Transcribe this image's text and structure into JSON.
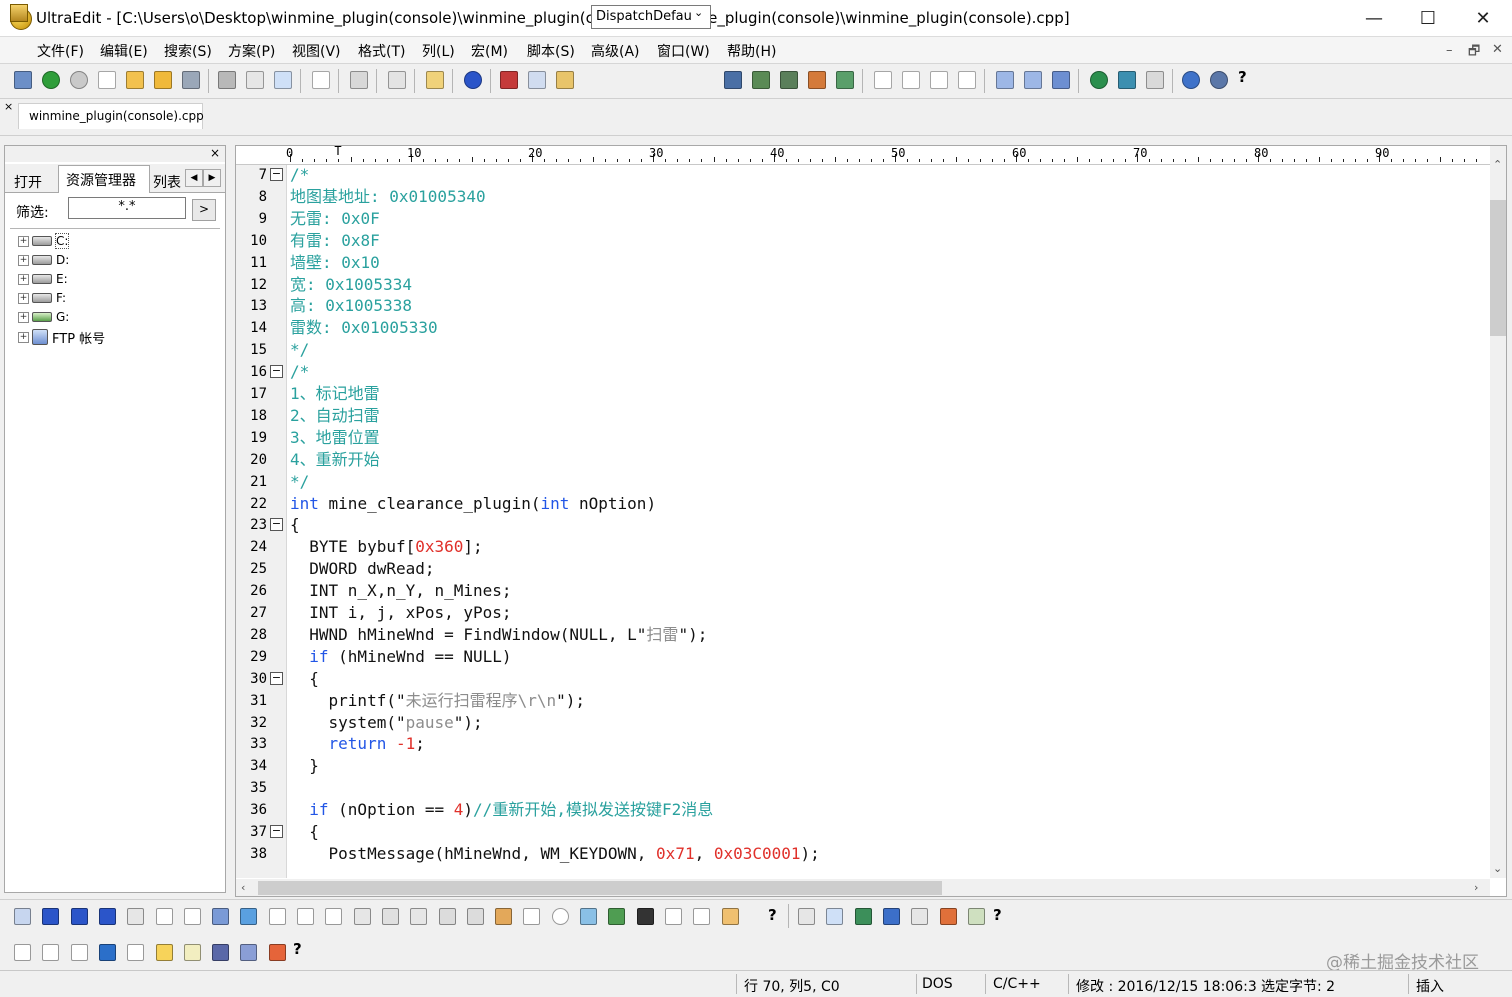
{
  "window": {
    "title": "UltraEdit - [C:\\Users\\o\\Desktop\\winmine_plugin(console)\\winmine_plugin(console)\\winmine_plugin(console)\\winmine_plugin(console).cpp]",
    "minimize": "—",
    "maximize": "☐",
    "close": "✕"
  },
  "menu": [
    "文件(F)",
    "编辑(E)",
    "搜索(S)",
    "方案(P)",
    "视图(V)",
    "格式(T)",
    "列(L)",
    "宏(M)",
    "脚本(S)",
    "高级(A)",
    "窗口(W)",
    "帮助(H)"
  ],
  "mdi": {
    "minimize": "–",
    "restore": "🗗",
    "close": "✕"
  },
  "toolbar": {
    "function_select": "DispatchDefau",
    "help_label": "?"
  },
  "tab": {
    "file": "winmine_plugin(console).cpp",
    "close": "×"
  },
  "panel": {
    "close": "×",
    "tabs": [
      "打开",
      "资源管理器",
      "列表"
    ],
    "filter_label": "筛选:",
    "filter_value": "*.*",
    "filter_go": ">",
    "tree": [
      {
        "label": "C:",
        "icon": "drive-icon"
      },
      {
        "label": "D:",
        "icon": "drive-icon"
      },
      {
        "label": "E:",
        "icon": "drive-icon"
      },
      {
        "label": "F:",
        "icon": "drive-icon"
      },
      {
        "label": "G:",
        "icon": "network-drive-icon"
      },
      {
        "label": "FTP 帐号",
        "icon": "ftp-icon"
      }
    ]
  },
  "ruler": {
    "labels": [
      "0",
      "10",
      "20",
      "30",
      "40",
      "50",
      "60",
      "70",
      "80",
      "90"
    ],
    "cursor_mark": "T"
  },
  "code": [
    {
      "n": "7",
      "fold": true,
      "parts": [
        [
          "c",
          "/*"
        ]
      ]
    },
    {
      "n": "8",
      "parts": [
        [
          "c",
          "地图基地址: 0x01005340"
        ]
      ]
    },
    {
      "n": "9",
      "parts": [
        [
          "c",
          "无雷: 0x0F"
        ]
      ]
    },
    {
      "n": "10",
      "parts": [
        [
          "c",
          "有雷: 0x8F"
        ]
      ]
    },
    {
      "n": "11",
      "parts": [
        [
          "c",
          "墙壁: 0x10"
        ]
      ]
    },
    {
      "n": "12",
      "parts": [
        [
          "c",
          "宽: 0x1005334"
        ]
      ]
    },
    {
      "n": "13",
      "parts": [
        [
          "c",
          "高: 0x1005338"
        ]
      ]
    },
    {
      "n": "14",
      "parts": [
        [
          "c",
          "雷数: 0x01005330"
        ]
      ]
    },
    {
      "n": "15",
      "parts": [
        [
          "c",
          "*/"
        ]
      ]
    },
    {
      "n": "16",
      "fold": true,
      "parts": [
        [
          "c",
          "/*"
        ]
      ]
    },
    {
      "n": "17",
      "parts": [
        [
          "c",
          "1、标记地雷"
        ]
      ]
    },
    {
      "n": "18",
      "parts": [
        [
          "c",
          "2、自动扫雷"
        ]
      ]
    },
    {
      "n": "19",
      "parts": [
        [
          "c",
          "3、地雷位置"
        ]
      ]
    },
    {
      "n": "20",
      "parts": [
        [
          "c",
          "4、重新开始"
        ]
      ]
    },
    {
      "n": "21",
      "parts": [
        [
          "c",
          "*/"
        ]
      ]
    },
    {
      "n": "22",
      "parts": [
        [
          "k",
          "int"
        ],
        [
          "t",
          " mine_clearance_plugin("
        ],
        [
          "k",
          "int"
        ],
        [
          "t",
          " nOption)"
        ]
      ]
    },
    {
      "n": "23",
      "fold": true,
      "parts": [
        [
          "t",
          "{"
        ]
      ]
    },
    {
      "n": "24",
      "parts": [
        [
          "t",
          "  BYTE bybuf["
        ],
        [
          "d",
          "0x360"
        ],
        [
          "t",
          "];"
        ]
      ]
    },
    {
      "n": "25",
      "parts": [
        [
          "t",
          "  DWORD dwRead;"
        ]
      ]
    },
    {
      "n": "26",
      "parts": [
        [
          "t",
          "  INT n_X,n_Y, n_Mines;"
        ]
      ]
    },
    {
      "n": "27",
      "parts": [
        [
          "t",
          "  INT i, j, xPos, yPos;"
        ]
      ]
    },
    {
      "n": "28",
      "parts": [
        [
          "t",
          "  HWND hMineWnd = FindWindow(NULL, L\""
        ],
        [
          "s",
          "扫雷"
        ],
        [
          "t",
          "\");"
        ]
      ]
    },
    {
      "n": "29",
      "parts": [
        [
          "t",
          "  "
        ],
        [
          "k",
          "if"
        ],
        [
          "t",
          " (hMineWnd == NULL)"
        ]
      ]
    },
    {
      "n": "30",
      "fold": true,
      "parts": [
        [
          "t",
          "  {"
        ]
      ]
    },
    {
      "n": "31",
      "parts": [
        [
          "t",
          "    printf(\""
        ],
        [
          "s",
          "未运行扫雷程序\\r\\n"
        ],
        [
          "t",
          "\");"
        ]
      ]
    },
    {
      "n": "32",
      "parts": [
        [
          "t",
          "    system(\""
        ],
        [
          "s",
          "pause"
        ],
        [
          "t",
          "\");"
        ]
      ]
    },
    {
      "n": "33",
      "parts": [
        [
          "t",
          "    "
        ],
        [
          "k",
          "return"
        ],
        [
          "t",
          " "
        ],
        [
          "d",
          "-1"
        ],
        [
          "t",
          ";"
        ]
      ]
    },
    {
      "n": "34",
      "parts": [
        [
          "t",
          "  }"
        ]
      ]
    },
    {
      "n": "35",
      "parts": [
        [
          "t",
          ""
        ]
      ]
    },
    {
      "n": "36",
      "parts": [
        [
          "t",
          "  "
        ],
        [
          "k",
          "if"
        ],
        [
          "t",
          " (nOption == "
        ],
        [
          "d",
          "4"
        ],
        [
          "t",
          ")"
        ],
        [
          "c",
          "//重新开始,模拟发送按键F2消息"
        ]
      ]
    },
    {
      "n": "37",
      "fold": true,
      "parts": [
        [
          "t",
          "  {"
        ]
      ]
    },
    {
      "n": "38",
      "parts": [
        [
          "t",
          "    PostMessage(hMineWnd, WM_KEYDOWN, "
        ],
        [
          "d",
          "0x71"
        ],
        [
          "t",
          ", "
        ],
        [
          "d",
          "0x03C0001"
        ],
        [
          "t",
          ");"
        ]
      ]
    }
  ],
  "bottom": {
    "help1": "?",
    "help2": "?",
    "help3": "?"
  },
  "status": {
    "position": "行 70, 列5, C0",
    "line_ending": "DOS",
    "language": "C/C++",
    "modified": "修改 : 2016/12/15 18:06:3",
    "selected": "选定字节: 2",
    "mode": "插入"
  },
  "watermark": "@稀土掘金技术社区",
  "colors": {
    "comment": "#2aa19e",
    "keyword": "#2256e6",
    "number": "#e0302a",
    "string": "#8c8c8c"
  }
}
